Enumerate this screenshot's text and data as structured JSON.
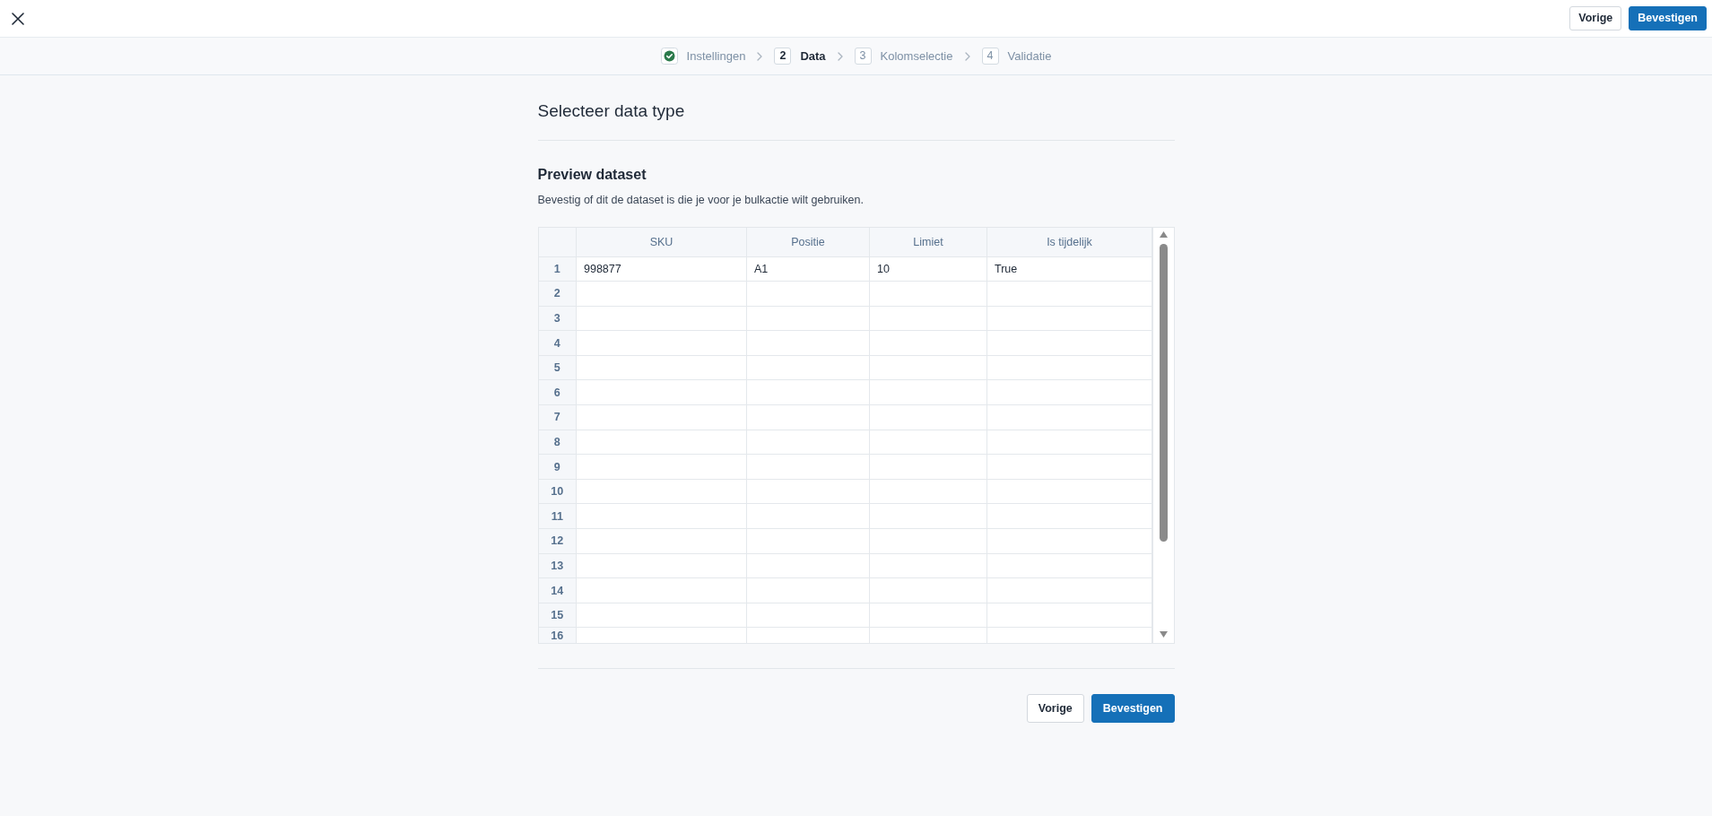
{
  "top_bar": {
    "buttons": [
      {
        "label": "Vorige",
        "kind": "secondary"
      },
      {
        "label": "Bevestigen",
        "kind": "primary"
      }
    ]
  },
  "steps": [
    {
      "label": "Instellingen",
      "completed": true,
      "selected": false
    },
    {
      "number": "2",
      "label": "Data",
      "completed": false,
      "selected": true
    },
    {
      "number": "3",
      "label": "Kolomselectie",
      "completed": false,
      "selected": false
    },
    {
      "number": "4",
      "label": "Validatie",
      "completed": false,
      "selected": false
    }
  ],
  "section_title": "Selecteer data type",
  "preview": {
    "title": "Preview dataset",
    "description": "Bevestig of dit de dataset is die je voor je bulkactie wilt gebruiken.",
    "table": {
      "columns": [
        "SKU",
        "Positie",
        "Limiet",
        "Is tijdelijk"
      ],
      "rows": [
        {
          "number": "1",
          "cells": [
            "998877",
            "A1",
            "10",
            "True"
          ]
        },
        {
          "number": "2"
        },
        {
          "number": "3"
        },
        {
          "number": "4"
        },
        {
          "number": "5"
        },
        {
          "number": "6"
        },
        {
          "number": "7"
        },
        {
          "number": "8"
        },
        {
          "number": "9"
        },
        {
          "number": "10"
        },
        {
          "number": "11"
        },
        {
          "number": "12"
        },
        {
          "number": "13"
        },
        {
          "number": "14"
        },
        {
          "number": "15"
        },
        {
          "number": "16"
        }
      ]
    }
  },
  "footer": {
    "buttons": [
      {
        "label": "Vorige",
        "kind": "secondary"
      },
      {
        "label": "Bevestigen",
        "kind": "primary"
      }
    ]
  }
}
